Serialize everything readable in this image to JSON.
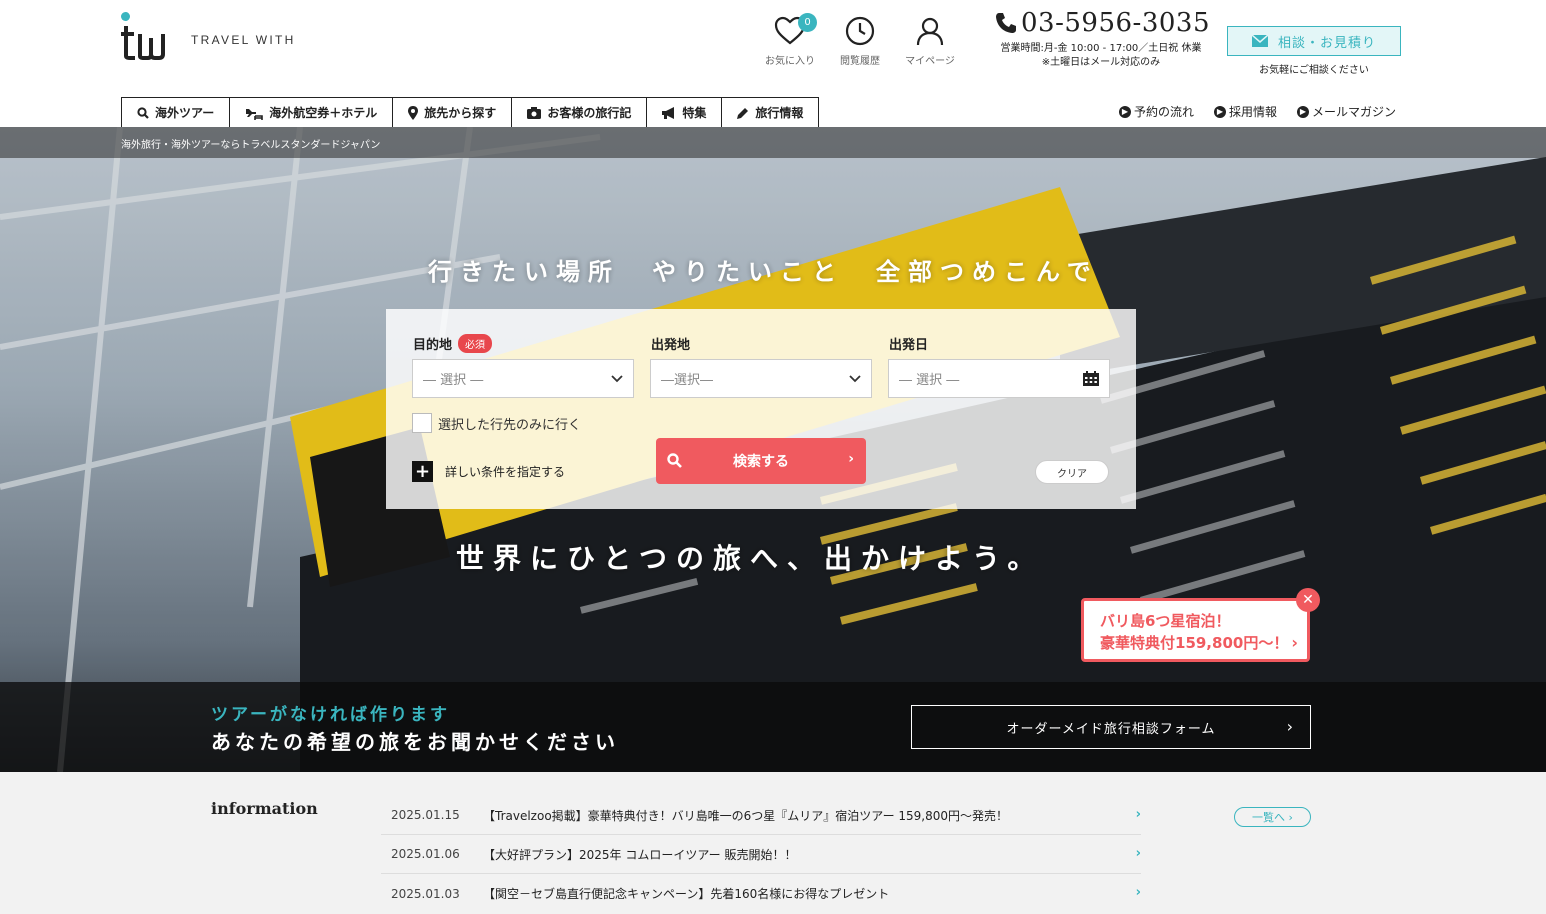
{
  "header": {
    "logo_text": "TRAVEL WITH",
    "icons": [
      {
        "label": "お気に入り",
        "badge": "0",
        "icon": "heart-icon"
      },
      {
        "label": "閲覧履歴",
        "icon": "clock-icon"
      },
      {
        "label": "マイページ",
        "icon": "user-icon"
      }
    ],
    "tel": "03-5956-3035",
    "hours_line1": "営業時間:月-金 10:00 - 17:00／土日祝 休業",
    "hours_line2": "※土曜日はメール対応のみ",
    "consult_label": "相談・お見積り",
    "consult_sub": "お気軽にご相談ください"
  },
  "gnav": [
    {
      "label": "海外ツアー",
      "icon": "search-icon"
    },
    {
      "label": "海外航空券＋ホテル",
      "icon": "plane-bed-icon"
    },
    {
      "label": "旅先から探す",
      "icon": "pin-icon"
    },
    {
      "label": "お客様の旅行記",
      "icon": "camera-icon"
    },
    {
      "label": "特集",
      "icon": "megaphone-icon"
    },
    {
      "label": "旅行情報",
      "icon": "pencil-icon"
    }
  ],
  "subnav": [
    "予約の流れ",
    "採用情報",
    "メールマガジン"
  ],
  "breadcrumb": "海外旅行・海外ツアーならトラベルスタンダードジャパン",
  "hero": {
    "title": "行きたい場所　やりたいこと　全部つめこんで",
    "subtitle": "世界にひとつの旅へ、出かけよう。"
  },
  "search": {
    "dest_label": "目的地",
    "required": "必須",
    "dest_value": "― 選択 ―",
    "origin_label": "出発地",
    "origin_value": "―選択―",
    "date_label": "出発日",
    "date_value": "― 選択 ―",
    "only_selected": "選択した行先のみに行く",
    "more_conditions": "詳しい条件を指定する",
    "search_button": "検索する",
    "clear_button": "クリア"
  },
  "promo": {
    "line1": "バリ島6つ星宿泊！",
    "line2": "豪華特典付159,800円～！"
  },
  "band": {
    "line1": "ツアーがなければ作ります",
    "line2": "あなたの希望の旅をお聞かせください",
    "button": "オーダーメイド旅行相談フォーム"
  },
  "info": {
    "title": "information",
    "all_button": "一覧へ",
    "items": [
      {
        "date": "2025.01.15",
        "text": "【Travelzoo掲載】豪華特典付き！バリ島唯一の6つ星『ムリア』宿泊ツアー 159,800円～発売！"
      },
      {
        "date": "2025.01.06",
        "text": "【大好評プラン】2025年 コムローイツアー 販売開始！！"
      },
      {
        "date": "2025.01.03",
        "text": "【関空－セブ島直行便記念キャンペーン】先着160名様にお得なプレゼント"
      }
    ]
  },
  "colors": {
    "accent": "#3ab5bf",
    "cta": "#f05a5f"
  }
}
